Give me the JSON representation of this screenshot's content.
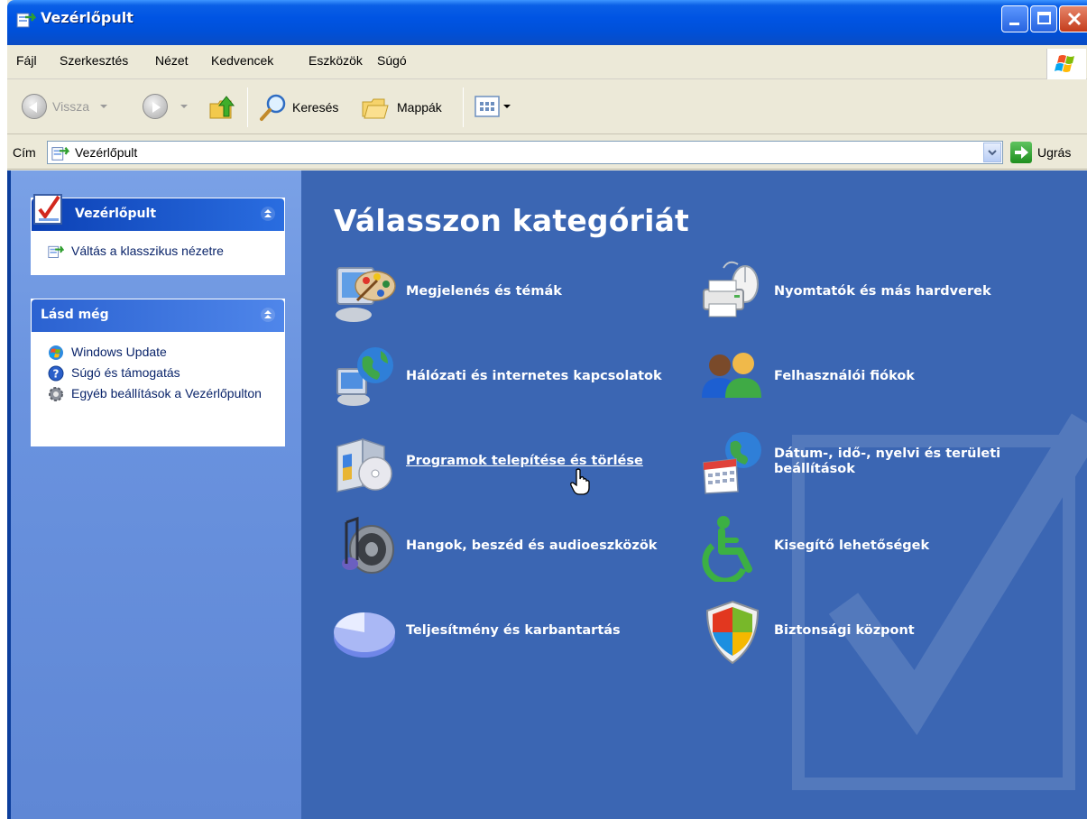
{
  "window": {
    "title": "Vezérlőpult",
    "title_icon": "control-panel-icon"
  },
  "menu": [
    "Fájl",
    "Szerkesztés",
    "Nézet",
    "Kedvencek",
    "Eszközök",
    "Súgó"
  ],
  "toolbar": {
    "back_label": "Vissza",
    "search_label": "Keresés",
    "folders_label": "Mappák"
  },
  "address": {
    "label": "Cím",
    "value": "Vezérlőpult",
    "go_label": "Ugrás"
  },
  "sidebar": {
    "panel1": {
      "title": "Vezérlőpult",
      "links": [
        {
          "label": "Váltás a klasszikus nézetre",
          "icon": "control-panel-icon"
        }
      ]
    },
    "panel2": {
      "title": "Lásd még",
      "links": [
        {
          "label": "Windows Update",
          "icon": "windows-update-icon"
        },
        {
          "label": "Súgó és támogatás",
          "icon": "help-icon"
        },
        {
          "label": "Egyéb beállítások a Vezérlőpulton",
          "icon": "gear-icon"
        }
      ]
    }
  },
  "main": {
    "heading": "Válasszon kategóriát",
    "categories": [
      {
        "label": "Megjelenés és témák",
        "icon": "appearance-icon"
      },
      {
        "label": "Nyomtatók és más hardverek",
        "icon": "printer-icon"
      },
      {
        "label": "Hálózati és internetes kapcsolatok",
        "icon": "network-icon"
      },
      {
        "label": "Felhasználói fiókok",
        "icon": "user-accounts-icon"
      },
      {
        "label": "Programok telepítése és törlése",
        "icon": "add-remove-programs-icon",
        "hovered": true
      },
      {
        "label": "Dátum-, idő-, nyelvi és területi beállítások",
        "icon": "date-time-icon"
      },
      {
        "label": "Hangok, beszéd és audioeszközök",
        "icon": "sound-icon"
      },
      {
        "label": "Kisegítő lehetőségek",
        "icon": "accessibility-icon"
      },
      {
        "label": "Teljesítmény és karbantartás",
        "icon": "performance-icon"
      },
      {
        "label": "Biztonsági központ",
        "icon": "security-center-icon"
      }
    ]
  },
  "colors": {
    "title_bar": "#0054e3",
    "main_bg": "#3b66b3",
    "sidebar_bg": "#6a93df",
    "link_text": "#0a246a"
  }
}
